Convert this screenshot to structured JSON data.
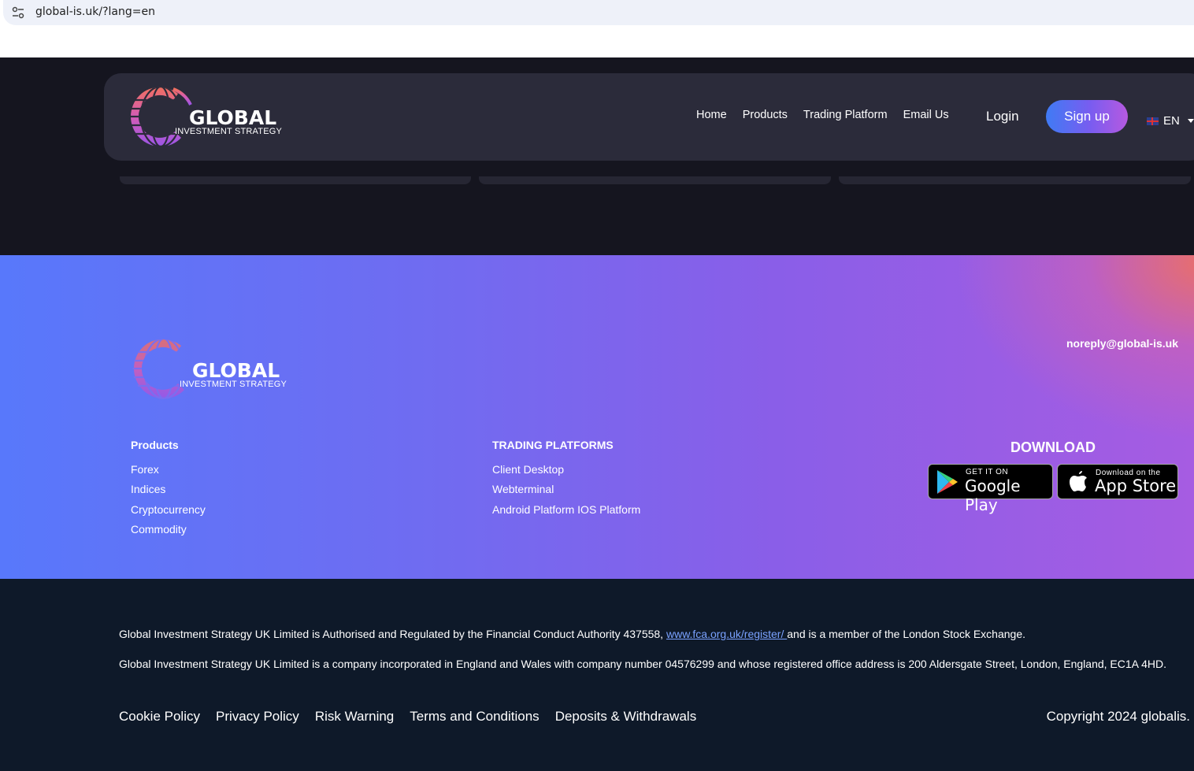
{
  "browser": {
    "url": "global-is.uk/?lang=en"
  },
  "brand": {
    "name": "GLOBAL",
    "tagline": "INVESTMENT STRATEGY"
  },
  "nav": {
    "links": [
      "Home",
      "Products",
      "Trading Platform",
      "Email Us"
    ],
    "login": "Login",
    "signup": "Sign up",
    "language": "EN"
  },
  "footer": {
    "email": "noreply@global-is.uk",
    "products": {
      "title": "Products",
      "items": [
        "Forex",
        "Indices",
        "Cryptocurrency",
        "Commodity"
      ]
    },
    "platforms": {
      "title": "TRADING PLATFORMS",
      "items": [
        "Client Desktop",
        "Webterminal",
        "Android Platform IOS Platform"
      ]
    },
    "download": {
      "title": "DOWNLOAD",
      "google_small": "GET IT ON",
      "google_big": "Google Play",
      "apple_small": "Download on the",
      "apple_big": "App Store"
    }
  },
  "legal": {
    "p1_before": "Global Investment Strategy UK Limited is Authorised and Regulated by the Financial Conduct Authority 437558, ",
    "p1_link": "www.fca.org.uk/register/ ",
    "p1_after": "and is a member of the London Stock Exchange.",
    "p2": "Global Investment Strategy UK Limited is a company incorporated in England and Wales with company number 04576299 and whose registered office address is 200 Aldersgate Street, London, England, EC1A 4HD.",
    "links": [
      "Cookie Policy",
      "Privacy Policy",
      "Risk Warning",
      "Terms and Conditions",
      "Deposits & Withdrawals"
    ],
    "copyright": "Copyright 2024 globalis."
  },
  "colors": {
    "hero_bg": "#15151f",
    "navbar_bg": "#2b2b3a",
    "legal_bg": "#0e1929",
    "gradient_start": "#5878fb",
    "gradient_end": "#a65ce2",
    "link": "#7aa2ff"
  }
}
